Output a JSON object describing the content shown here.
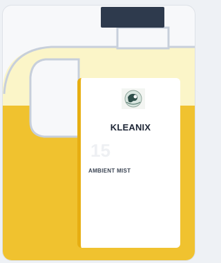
{
  "product": {
    "brand": "KLEANIX",
    "volume": "15",
    "scent": "AMBIENT MIST"
  },
  "colors": {
    "liquid": "#f0c22f",
    "bottle_tint": "#fbf5c8",
    "outline": "#c7cfdb",
    "cap": "#2e3a4d",
    "label_stripe": "#e7ae12",
    "text_dark": "#1e2636"
  },
  "icons": {
    "logo": "globe-emblem-icon",
    "cap": "bottle-cap-icon",
    "handle": "bottle-handle-icon"
  }
}
